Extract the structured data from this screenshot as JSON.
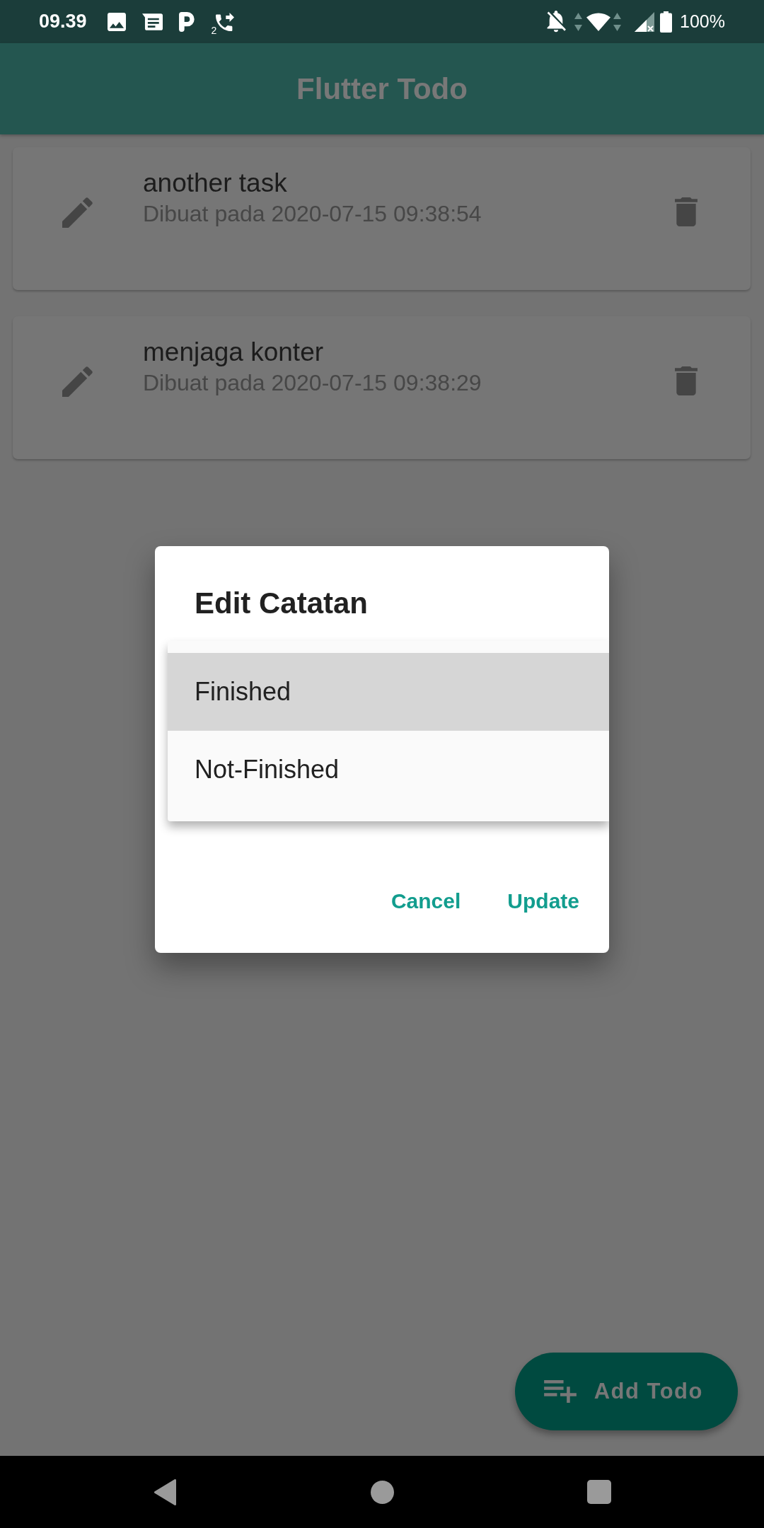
{
  "status_bar": {
    "time": "09.39",
    "call_badge": "2",
    "battery": "100%"
  },
  "app_bar": {
    "title": "Flutter Todo"
  },
  "todos": [
    {
      "title": "another task",
      "created": "Dibuat pada 2020-07-15 09:38:54"
    },
    {
      "title": "menjaga konter",
      "created": "Dibuat pada 2020-07-15 09:38:29"
    }
  ],
  "dialog": {
    "title": "Edit Catatan",
    "dropdown_menu": {
      "items": [
        {
          "label": "Finished",
          "selected": true
        },
        {
          "label": "Not-Finished",
          "selected": false
        }
      ]
    },
    "buttons": [
      "Cancel",
      "Update"
    ]
  },
  "fab": {
    "label": "Add Todo"
  }
}
